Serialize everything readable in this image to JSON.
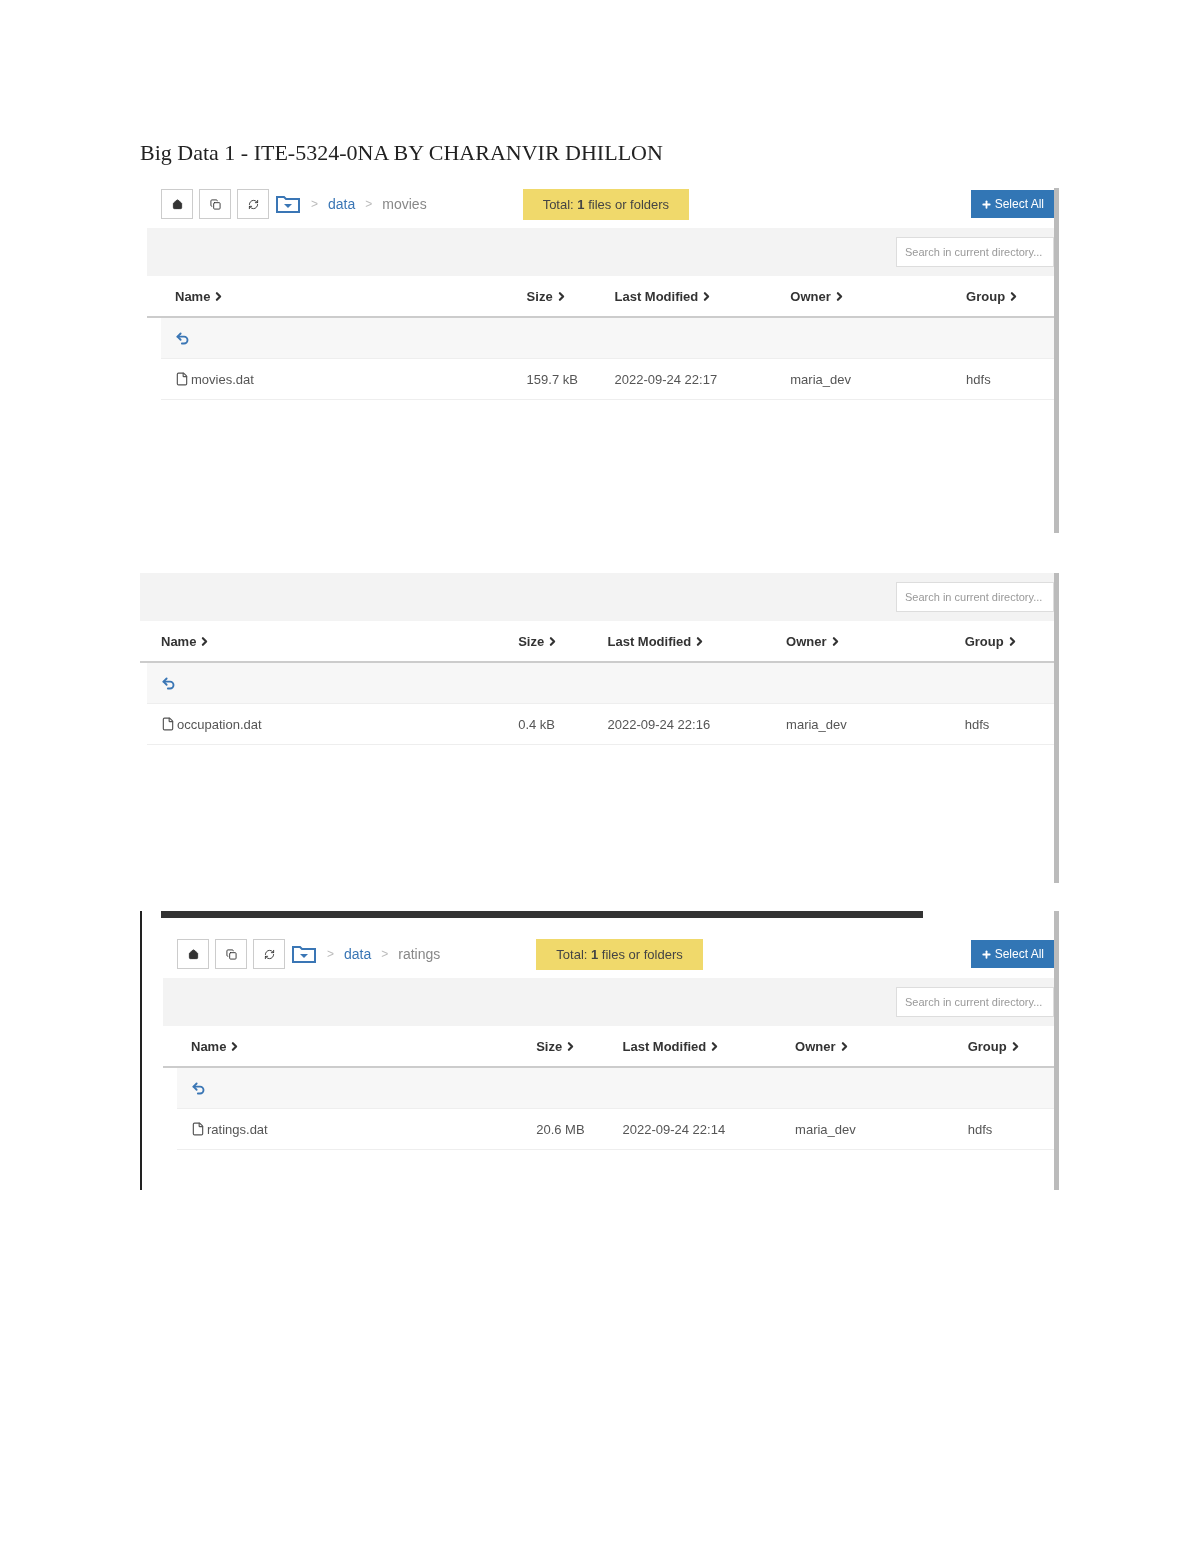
{
  "document_title": "Big Data 1 - ITE-5324-0NA BY CHARANVIR DHILLON",
  "panels": [
    {
      "toolbar": {
        "separator": ">",
        "breadcrumb": [
          "data",
          "movies"
        ],
        "total": "Total: **1** files or folders",
        "select_all": "Select All"
      },
      "search": {
        "placeholder": "Search in current directory..."
      },
      "columns": [
        "Name",
        "Size",
        "Last Modified",
        "Owner",
        "Group"
      ],
      "rows": [
        {
          "kind": "parent"
        },
        {
          "kind": "file",
          "cells": [
            "movies.dat",
            "159.7 kB",
            "2022-09-24 22:17",
            "maria_dev",
            "hdfs"
          ]
        }
      ]
    },
    {
      "search": {
        "placeholder": "Search in current directory..."
      },
      "columns": [
        "Name",
        "Size",
        "Last Modified",
        "Owner",
        "Group"
      ],
      "rows": [
        {
          "kind": "parent"
        },
        {
          "kind": "file",
          "cells": [
            "occupation.dat",
            "0.4 kB",
            "2022-09-24 22:16",
            "maria_dev",
            "hdfs"
          ]
        }
      ]
    },
    {
      "top_bar": true,
      "toolbar": {
        "separator": ">",
        "breadcrumb": [
          "data",
          "ratings"
        ],
        "total": "Total: **1** files or folders",
        "select_all": "Select All"
      },
      "search": {
        "placeholder": "Search in current directory..."
      },
      "columns": [
        "Name",
        "Size",
        "Last Modified",
        "Owner",
        "Group"
      ],
      "rows": [
        {
          "kind": "parent"
        },
        {
          "kind": "file",
          "cells": [
            "ratings.dat",
            "20.6 MB",
            "2022-09-24 22:14",
            "maria_dev",
            "hdfs"
          ]
        }
      ]
    }
  ]
}
